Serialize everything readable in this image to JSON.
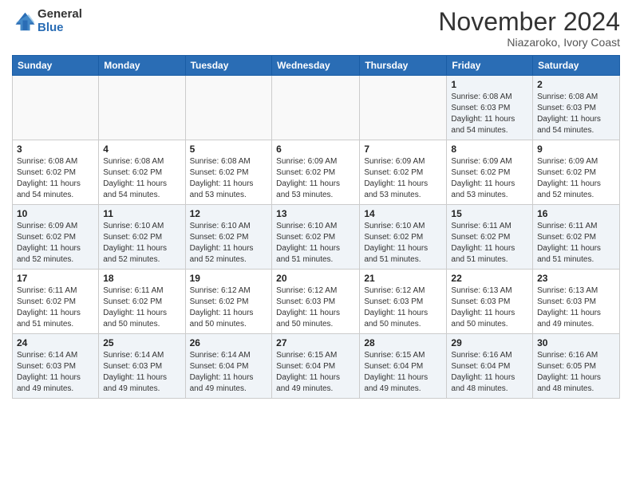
{
  "header": {
    "logo_general": "General",
    "logo_blue": "Blue",
    "main_title": "November 2024",
    "subtitle": "Niazaroko, Ivory Coast"
  },
  "calendar": {
    "days_of_week": [
      "Sunday",
      "Monday",
      "Tuesday",
      "Wednesday",
      "Thursday",
      "Friday",
      "Saturday"
    ],
    "weeks": [
      {
        "days": [
          {
            "num": "",
            "info": ""
          },
          {
            "num": "",
            "info": ""
          },
          {
            "num": "",
            "info": ""
          },
          {
            "num": "",
            "info": ""
          },
          {
            "num": "",
            "info": ""
          },
          {
            "num": "1",
            "info": "Sunrise: 6:08 AM\nSunset: 6:03 PM\nDaylight: 11 hours\nand 54 minutes."
          },
          {
            "num": "2",
            "info": "Sunrise: 6:08 AM\nSunset: 6:03 PM\nDaylight: 11 hours\nand 54 minutes."
          }
        ]
      },
      {
        "days": [
          {
            "num": "3",
            "info": "Sunrise: 6:08 AM\nSunset: 6:02 PM\nDaylight: 11 hours\nand 54 minutes."
          },
          {
            "num": "4",
            "info": "Sunrise: 6:08 AM\nSunset: 6:02 PM\nDaylight: 11 hours\nand 54 minutes."
          },
          {
            "num": "5",
            "info": "Sunrise: 6:08 AM\nSunset: 6:02 PM\nDaylight: 11 hours\nand 53 minutes."
          },
          {
            "num": "6",
            "info": "Sunrise: 6:09 AM\nSunset: 6:02 PM\nDaylight: 11 hours\nand 53 minutes."
          },
          {
            "num": "7",
            "info": "Sunrise: 6:09 AM\nSunset: 6:02 PM\nDaylight: 11 hours\nand 53 minutes."
          },
          {
            "num": "8",
            "info": "Sunrise: 6:09 AM\nSunset: 6:02 PM\nDaylight: 11 hours\nand 53 minutes."
          },
          {
            "num": "9",
            "info": "Sunrise: 6:09 AM\nSunset: 6:02 PM\nDaylight: 11 hours\nand 52 minutes."
          }
        ]
      },
      {
        "days": [
          {
            "num": "10",
            "info": "Sunrise: 6:09 AM\nSunset: 6:02 PM\nDaylight: 11 hours\nand 52 minutes."
          },
          {
            "num": "11",
            "info": "Sunrise: 6:10 AM\nSunset: 6:02 PM\nDaylight: 11 hours\nand 52 minutes."
          },
          {
            "num": "12",
            "info": "Sunrise: 6:10 AM\nSunset: 6:02 PM\nDaylight: 11 hours\nand 52 minutes."
          },
          {
            "num": "13",
            "info": "Sunrise: 6:10 AM\nSunset: 6:02 PM\nDaylight: 11 hours\nand 51 minutes."
          },
          {
            "num": "14",
            "info": "Sunrise: 6:10 AM\nSunset: 6:02 PM\nDaylight: 11 hours\nand 51 minutes."
          },
          {
            "num": "15",
            "info": "Sunrise: 6:11 AM\nSunset: 6:02 PM\nDaylight: 11 hours\nand 51 minutes."
          },
          {
            "num": "16",
            "info": "Sunrise: 6:11 AM\nSunset: 6:02 PM\nDaylight: 11 hours\nand 51 minutes."
          }
        ]
      },
      {
        "days": [
          {
            "num": "17",
            "info": "Sunrise: 6:11 AM\nSunset: 6:02 PM\nDaylight: 11 hours\nand 51 minutes."
          },
          {
            "num": "18",
            "info": "Sunrise: 6:11 AM\nSunset: 6:02 PM\nDaylight: 11 hours\nand 50 minutes."
          },
          {
            "num": "19",
            "info": "Sunrise: 6:12 AM\nSunset: 6:02 PM\nDaylight: 11 hours\nand 50 minutes."
          },
          {
            "num": "20",
            "info": "Sunrise: 6:12 AM\nSunset: 6:03 PM\nDaylight: 11 hours\nand 50 minutes."
          },
          {
            "num": "21",
            "info": "Sunrise: 6:12 AM\nSunset: 6:03 PM\nDaylight: 11 hours\nand 50 minutes."
          },
          {
            "num": "22",
            "info": "Sunrise: 6:13 AM\nSunset: 6:03 PM\nDaylight: 11 hours\nand 50 minutes."
          },
          {
            "num": "23",
            "info": "Sunrise: 6:13 AM\nSunset: 6:03 PM\nDaylight: 11 hours\nand 49 minutes."
          }
        ]
      },
      {
        "days": [
          {
            "num": "24",
            "info": "Sunrise: 6:14 AM\nSunset: 6:03 PM\nDaylight: 11 hours\nand 49 minutes."
          },
          {
            "num": "25",
            "info": "Sunrise: 6:14 AM\nSunset: 6:03 PM\nDaylight: 11 hours\nand 49 minutes."
          },
          {
            "num": "26",
            "info": "Sunrise: 6:14 AM\nSunset: 6:04 PM\nDaylight: 11 hours\nand 49 minutes."
          },
          {
            "num": "27",
            "info": "Sunrise: 6:15 AM\nSunset: 6:04 PM\nDaylight: 11 hours\nand 49 minutes."
          },
          {
            "num": "28",
            "info": "Sunrise: 6:15 AM\nSunset: 6:04 PM\nDaylight: 11 hours\nand 49 minutes."
          },
          {
            "num": "29",
            "info": "Sunrise: 6:16 AM\nSunset: 6:04 PM\nDaylight: 11 hours\nand 48 minutes."
          },
          {
            "num": "30",
            "info": "Sunrise: 6:16 AM\nSunset: 6:05 PM\nDaylight: 11 hours\nand 48 minutes."
          }
        ]
      }
    ]
  }
}
